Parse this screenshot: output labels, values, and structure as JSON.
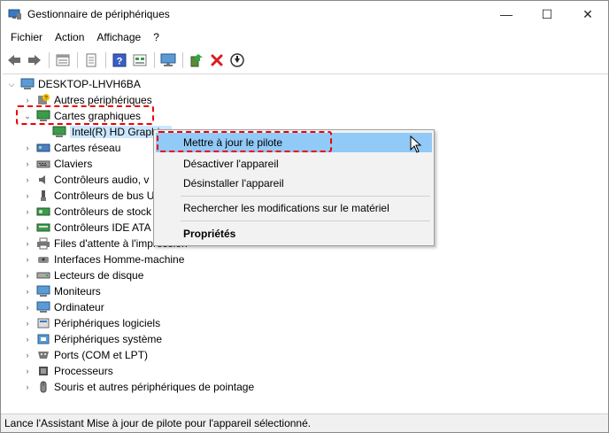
{
  "window": {
    "title": "Gestionnaire de périphériques",
    "min_glyph": "—",
    "max_glyph": "☐",
    "close_glyph": "✕"
  },
  "menu": [
    "Fichier",
    "Action",
    "Affichage",
    "?"
  ],
  "toolbar_icons": [
    "back-icon",
    "forward-icon",
    "properties-icon",
    "help-page-icon",
    "help-icon",
    "view-icon",
    "monitor-icon",
    "update-driver-icon",
    "uninstall-icon",
    "download-icon"
  ],
  "tree": {
    "root": "DESKTOP-LHVH6BA",
    "items": [
      {
        "label": "Autres périphériques",
        "expanded": false
      },
      {
        "label": "Cartes graphiques",
        "expanded": true
      },
      {
        "label": "Intel(R) HD Graphics",
        "child": true
      },
      {
        "label": "Cartes réseau",
        "expanded": false
      },
      {
        "label": "Claviers",
        "expanded": false
      },
      {
        "label": "Contrôleurs audio, v",
        "expanded": false
      },
      {
        "label": "Contrôleurs de bus U",
        "expanded": false
      },
      {
        "label": "Contrôleurs de stock",
        "expanded": false
      },
      {
        "label": "Contrôleurs IDE ATA",
        "expanded": false
      },
      {
        "label": "Files d'attente à l'impression",
        "expanded": false
      },
      {
        "label": "Interfaces Homme-machine",
        "expanded": false
      },
      {
        "label": "Lecteurs de disque",
        "expanded": false
      },
      {
        "label": "Moniteurs",
        "expanded": false
      },
      {
        "label": "Ordinateur",
        "expanded": false
      },
      {
        "label": "Périphériques logiciels",
        "expanded": false
      },
      {
        "label": "Périphériques système",
        "expanded": false
      },
      {
        "label": "Ports (COM et LPT)",
        "expanded": false
      },
      {
        "label": "Processeurs",
        "expanded": false
      },
      {
        "label": "Souris et autres périphériques de pointage",
        "expanded": false
      }
    ]
  },
  "context_menu": {
    "update_driver": "Mettre à jour le pilote",
    "disable": "Désactiver l'appareil",
    "uninstall": "Désinstaller l'appareil",
    "scan": "Rechercher les modifications sur le matériel",
    "properties": "Propriétés"
  },
  "status": "Lance l'Assistant Mise à jour de pilote pour l'appareil sélectionné.",
  "colors": {
    "highlight_red": "#e00000",
    "hover_blue": "#91c9f7",
    "selection_blue": "#cce8ff"
  }
}
